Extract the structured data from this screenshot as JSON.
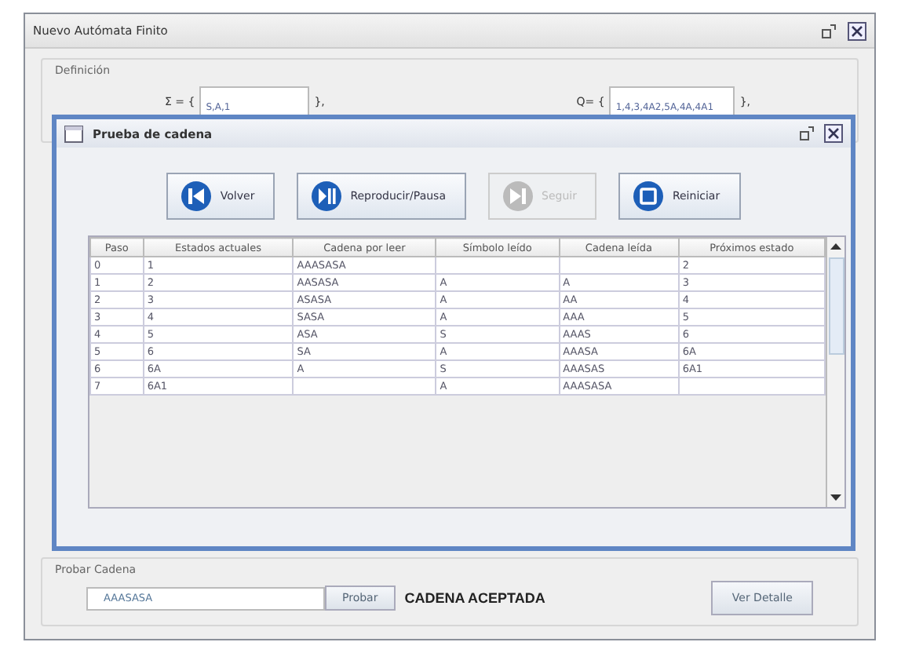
{
  "window": {
    "title": "Nuevo Autómata Finito"
  },
  "definition": {
    "title": "Definición",
    "sigma_label": "Σ = {",
    "sigma_value": "S,A,1",
    "sigma_close": "},",
    "q_label": "Q= {",
    "q_value": "1,4,3,4A2,5A,4A,4A1",
    "q_close": "},"
  },
  "dialog": {
    "title": "Prueba de cadena",
    "buttons": [
      {
        "label": "Volver",
        "kind": "back",
        "disabled": false
      },
      {
        "label": "Reproducir/Pausa",
        "kind": "play",
        "disabled": false
      },
      {
        "label": "Seguir",
        "kind": "next",
        "disabled": true
      },
      {
        "label": "Reiniciar",
        "kind": "reset",
        "disabled": false
      }
    ],
    "table": {
      "columns": [
        "Paso",
        "Estados actuales",
        "Cadena por leer",
        "Símbolo leído",
        "Cadena leída",
        "Próximos estado"
      ],
      "rows": [
        [
          "0",
          "1",
          "AAASASA",
          "",
          "",
          "2"
        ],
        [
          "1",
          "2",
          "AASASA",
          "A",
          "A",
          "3"
        ],
        [
          "2",
          "3",
          "ASASA",
          "A",
          "AA",
          "4"
        ],
        [
          "3",
          "4",
          "SASA",
          "A",
          "AAA",
          "5"
        ],
        [
          "4",
          "5",
          "ASA",
          "S",
          "AAAS",
          "6"
        ],
        [
          "5",
          "6",
          "SA",
          "A",
          "AAASA",
          "6A"
        ],
        [
          "6",
          "6A",
          "A",
          "S",
          "AAASAS",
          "6A1"
        ],
        [
          "7",
          "6A1",
          "",
          "A",
          "AAASASA",
          ""
        ]
      ]
    }
  },
  "test": {
    "title": "Probar Cadena",
    "value": "AAASASA",
    "button": "Probar",
    "result": "CADENA ACEPTADA",
    "detail_button": "Ver Detalle"
  }
}
